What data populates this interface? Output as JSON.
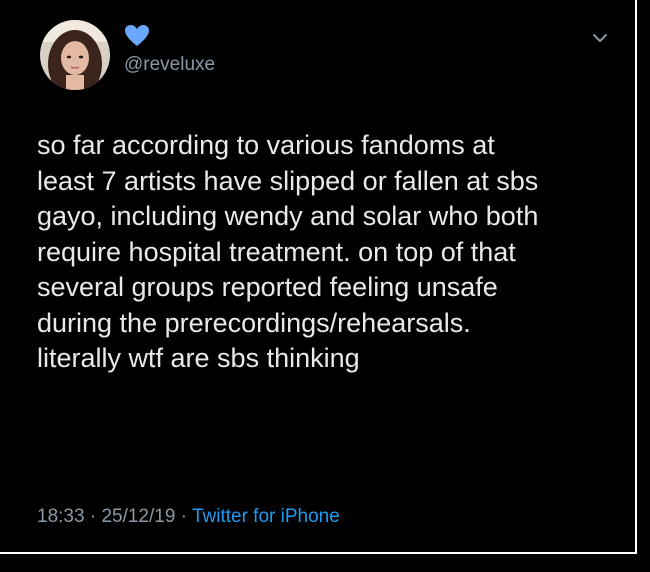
{
  "tweet": {
    "handle": "@reveluxe",
    "display_name_icon": "blue-heart-icon",
    "text": "so far according to various fandoms at\nleast 7 artists have slipped or fallen at sbs\ngayo, including wendy and solar who both\nrequire hospital treatment. on top of that\nseveral groups reported feeling unsafe\nduring the prerecordings/rehearsals.\nliterally wtf are sbs thinking",
    "time": "18:33",
    "date": "25/12/19",
    "separator": " · ",
    "source": "Twitter for iPhone"
  },
  "icons": {
    "heart": "blue-heart-icon",
    "menu": "chevron-down-icon",
    "avatar": "profile-photo"
  },
  "colors": {
    "background": "#000000",
    "text": "#e9e9ea",
    "muted": "#8b98a5",
    "link": "#1d9bf0",
    "heart": "#6aa8ff"
  }
}
